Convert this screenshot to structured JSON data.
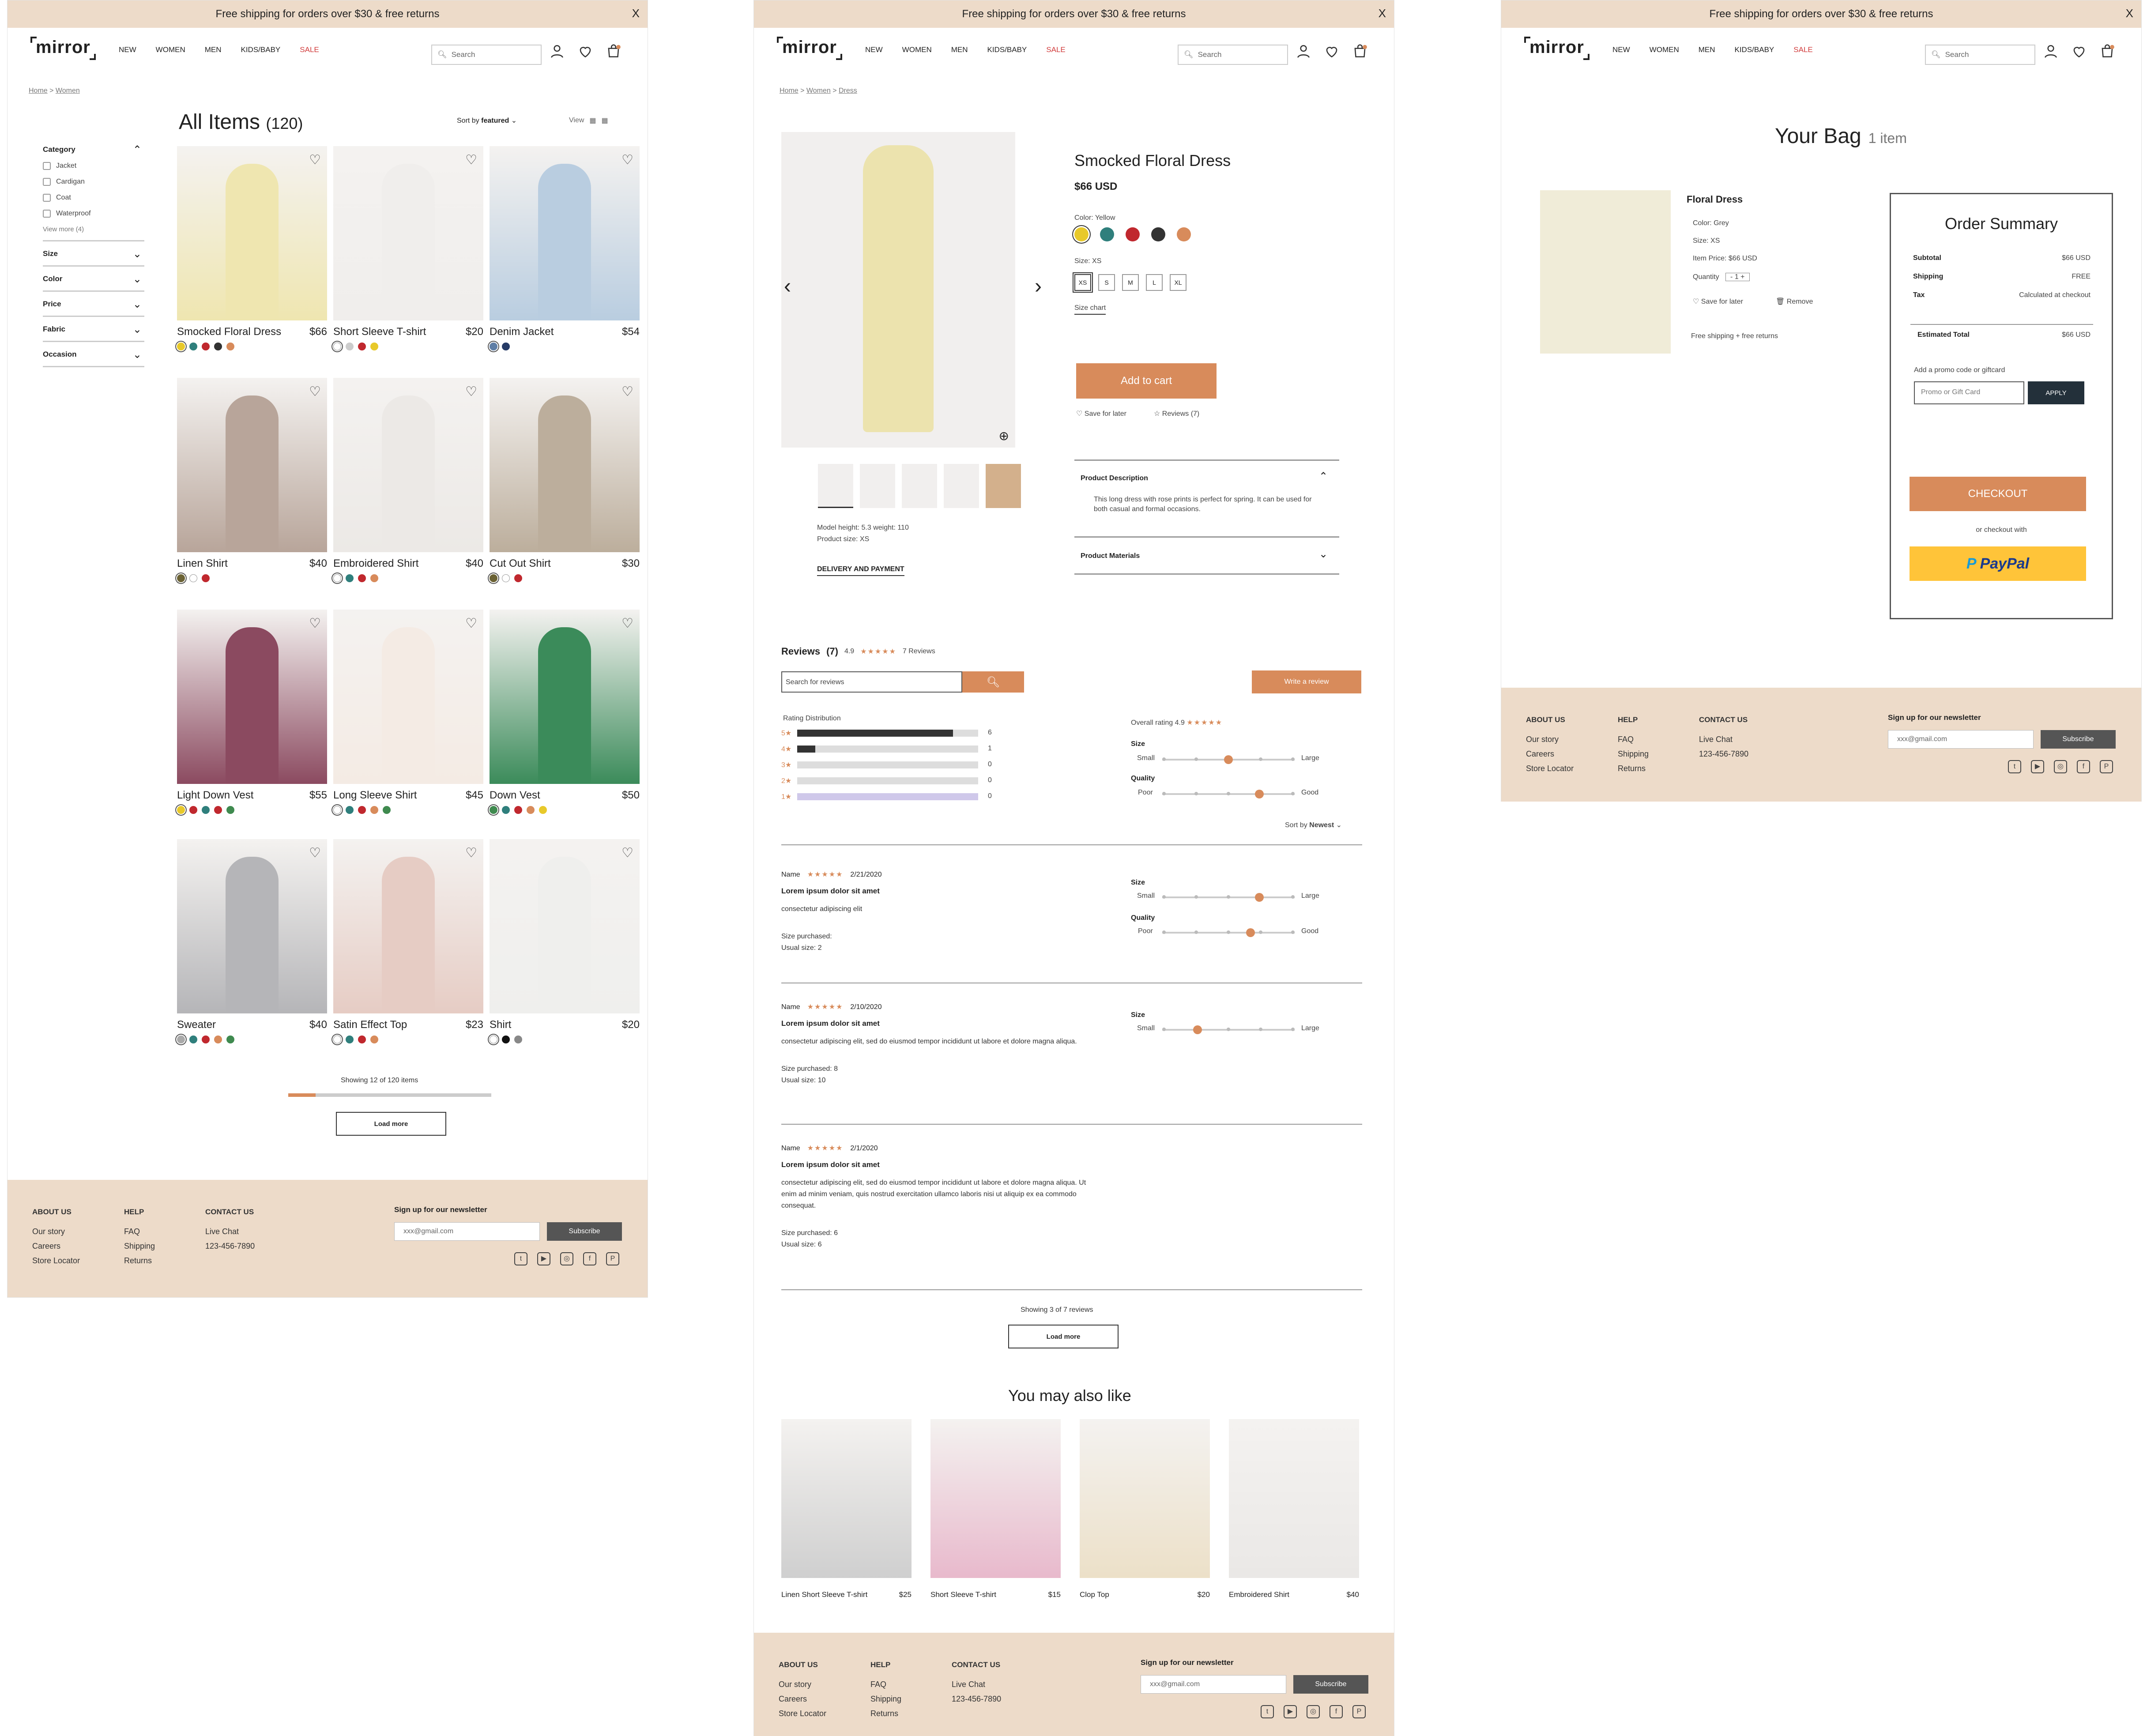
{
  "banner": {
    "text": "Free shipping  for orders over $30 & free returns",
    "close": "X"
  },
  "brand": {
    "logo": "mirror"
  },
  "nav": {
    "items": [
      "NEW",
      "WOMEN",
      "MEN",
      "KIDS/BABY"
    ],
    "sale": "SALE"
  },
  "search": {
    "placeholder": "Search"
  },
  "listing": {
    "crumb": [
      "Home",
      "Women"
    ],
    "title": "All Items",
    "count": "(120)",
    "sort_label": "Sort by",
    "sort_value": "featured",
    "view_label": "View",
    "filters": {
      "category_title": "Category",
      "category_options": [
        "Jacket",
        "Cardigan",
        "Coat",
        "Waterproof"
      ],
      "view_more": "View more (4)",
      "sections": [
        "Size",
        "Color",
        "Price",
        "Fabric",
        "Occasion"
      ]
    },
    "products": [
      {
        "name": "Smocked Floral Dress",
        "price": "$66",
        "img": "#efe6b0",
        "swatches": [
          "#e8c92a",
          "#2f7f7c",
          "#c0282e",
          "#333333",
          "#d88b5b"
        ]
      },
      {
        "name": "Short Sleeve T-shirt",
        "price": "$20",
        "img": "#f0eeec",
        "swatches": [
          "#ffffff",
          "#cccccc",
          "#c0282e",
          "#e8c92a"
        ]
      },
      {
        "name": "Denim Jacket",
        "price": "$54",
        "img": "#b9cde0",
        "swatches": [
          "#5e7ea6",
          "#263b66"
        ]
      },
      {
        "name": "Linen Shirt",
        "price": "$40",
        "img": "#b8a59a",
        "swatches": [
          "#6b6234",
          "#ffffff",
          "#c0282e"
        ]
      },
      {
        "name": "Embroidered Shirt",
        "price": "$40",
        "img": "#ece9e6",
        "swatches": [
          "#ffffff",
          "#2f7f7c",
          "#c0282e",
          "#d88b5b"
        ]
      },
      {
        "name": "Cut Out Shirt",
        "price": "$30",
        "img": "#bcae9c",
        "swatches": [
          "#6b6234",
          "#ffffff",
          "#c0282e"
        ]
      },
      {
        "name": "Light Down Vest",
        "price": "$55",
        "img": "#8b4a60",
        "swatches": [
          "#e8c92a",
          "#c0282e",
          "#2f7f7c",
          "#c0282e",
          "#3f8a4f"
        ]
      },
      {
        "name": "Long Sleeve Shirt",
        "price": "$45",
        "img": "#f4ebe4",
        "swatches": [
          "#ffffff",
          "#2f7f7c",
          "#c0282e",
          "#d88b5b",
          "#3f8a4f"
        ]
      },
      {
        "name": "Down Vest",
        "price": "$50",
        "img": "#3b8b5a",
        "swatches": [
          "#3f8a4f",
          "#2f7f7c",
          "#c0282e",
          "#d88b5b",
          "#e8c92a"
        ]
      },
      {
        "name": "Sweater",
        "price": "$40",
        "img": "#b5b5b8",
        "swatches": [
          "#aaaaaa",
          "#2f7f7c",
          "#c0282e",
          "#d88b5b",
          "#3f8a4f"
        ]
      },
      {
        "name": "Satin Effect Top",
        "price": "$23",
        "img": "#e6ccc4",
        "swatches": [
          "#ffffff",
          "#2f7f7c",
          "#c0282e",
          "#d88b5b"
        ]
      },
      {
        "name": "Shirt",
        "price": "$20",
        "img": "#efefed",
        "swatches": [
          "#ffffff",
          "#111111",
          "#888888"
        ]
      }
    ],
    "showing": "Showing 12 of 120 items",
    "load_more": "Load more",
    "load_progress": 0.1
  },
  "product": {
    "crumb": [
      "Home",
      "Women",
      "Dress"
    ],
    "name": "Smocked Floral Dress",
    "price": "$66 USD",
    "color_label": "Color: Yellow",
    "colors": [
      "#e8c92a",
      "#2f7f7c",
      "#c0282e",
      "#333333",
      "#d88b5b"
    ],
    "size_label": "Size: XS",
    "sizes": [
      "XS",
      "S",
      "M",
      "L",
      "XL"
    ],
    "size_chart": "Size chart",
    "add_to_cart": "Add to cart",
    "save_for_later": "Save for later",
    "reviews_link": "Reviews (7)",
    "model_info": "Model height: 5.3 weight: 110",
    "product_size": "Product size: XS",
    "delivery": "DELIVERY AND PAYMENT",
    "desc_title": "Product Description",
    "desc_text": "This long dress with rose prints is perfect for spring. It can be used for both casual and formal occasions.",
    "materials_title": "Product Materials"
  },
  "reviews": {
    "title": "Reviews",
    "count": "(7)",
    "rating": "4.9",
    "stars": "★★★★★",
    "total": "7 Reviews",
    "search_placeholder": "Search for reviews",
    "write": "Write a review",
    "dist_title": "Rating Distribution",
    "dist": [
      {
        "label": "5★",
        "count": "6",
        "frac": 0.86
      },
      {
        "label": "4★",
        "count": "1",
        "frac": 0.1
      },
      {
        "label": "3★",
        "count": "0",
        "frac": 0
      },
      {
        "label": "2★",
        "count": "0",
        "frac": 0
      },
      {
        "label": "1★",
        "count": "0",
        "frac": 0
      }
    ],
    "overall_label": "Overall rating",
    "overall_value": "4.9",
    "size_label": "Size",
    "size_small": "Small",
    "size_large": "Large",
    "size_pos": 0.5,
    "quality_label": "Quality",
    "quality_poor": "Poor",
    "quality_good": "Good",
    "quality_pos": 0.75,
    "sort_label": "Sort by",
    "sort_value": "Newest",
    "items": [
      {
        "name": "Name",
        "date": "2/21/2020",
        "title": "Lorem ipsum dolor sit amet",
        "body": "consectetur adipiscing elit",
        "purchased": "Size purchased:",
        "usual": "Usual size: 2",
        "size_pos": 0.75,
        "quality_pos": 0.68
      },
      {
        "name": "Name",
        "date": "2/10/2020",
        "title": "Lorem ipsum dolor sit amet",
        "body": "consectetur adipiscing elit, sed do eiusmod tempor incididunt ut labore et dolore magna aliqua.",
        "purchased": "Size purchased: 8",
        "usual": "Usual size: 10",
        "size_pos": 0.25
      },
      {
        "name": "Name",
        "date": "2/1/2020",
        "title": "Lorem ipsum dolor sit amet",
        "body": "consectetur adipiscing elit, sed do eiusmod tempor incididunt ut labore et dolore magna aliqua. Ut enim ad minim veniam, quis nostrud exercitation ullamco laboris nisi ut aliquip ex ea commodo consequat.",
        "purchased": "Size purchased: 6",
        "usual": "Usual size: 6"
      }
    ],
    "showing": "Showing 3 of 7 reviews",
    "load_more": "Load more"
  },
  "also_like": {
    "title": "You may also like",
    "items": [
      {
        "name": "Linen Short Sleeve T-shirt",
        "price": "$25",
        "img": "#cfcfcf"
      },
      {
        "name": "Short Sleeve T-shirt",
        "price": "$15",
        "img": "#e8b9cc"
      },
      {
        "name": "Clop Top",
        "price": "$20",
        "img": "#ece0c8"
      },
      {
        "name": "Embroidered Shirt",
        "price": "$40",
        "img": "#eae8e6"
      }
    ]
  },
  "bag": {
    "title": "Your Bag",
    "count": "1 item",
    "item_name": "Floral Dress",
    "color": "Color: Grey",
    "size": "Size: XS",
    "unit_price": "Item Price: $66 USD",
    "quantity_label": "Quantity",
    "quantity": "1",
    "save": "Save for later",
    "remove": "Remove",
    "shipping_note": "Free shipping + free returns",
    "summary_title": "Order Summary",
    "rows": [
      {
        "k": "Subtotal",
        "v": "$66 USD"
      },
      {
        "k": "Shipping",
        "v": "FREE"
      },
      {
        "k": "Tax",
        "v": "Calculated at checkout"
      }
    ],
    "est_label": "Estimated Total",
    "est_value": "$66 USD",
    "promo_label": "Add a promo code or giftcard",
    "promo_placeholder": "Promo or Gift Card",
    "apply": "APPLY",
    "checkout": "CHECKOUT",
    "or_with": "or checkout with",
    "paypal": "PayPal"
  },
  "footer": {
    "about_title": "ABOUT US",
    "about_links": [
      "Our story",
      "Careers",
      "Store Locator"
    ],
    "help_title": "HELP",
    "help_links": [
      "FAQ",
      "Shipping",
      "Returns"
    ],
    "contact_title": "CONTACT US",
    "contact_lines": [
      "Live Chat",
      "123-456-7890"
    ],
    "newsletter_title": "Sign up for our newsletter",
    "newsletter_placeholder": "xxx@gmail.com",
    "subscribe": "Subscribe",
    "social": [
      "twitter-icon",
      "youtube-icon",
      "instagram-icon",
      "facebook-icon",
      "pinterest-icon"
    ]
  }
}
